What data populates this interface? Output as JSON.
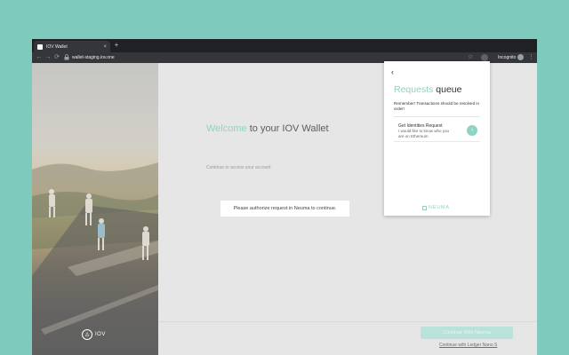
{
  "browser": {
    "tab_title": "IOV Wallet",
    "tab_close": "×",
    "new_tab": "+",
    "back": "←",
    "forward": "→",
    "reload": "⟳",
    "lock": "🔒",
    "url": "wallet-staging.iov.one",
    "star": "☆",
    "incognito": "Incognito",
    "menu": "⋮"
  },
  "page": {
    "welcome_accent": "Welcome",
    "welcome_rest": " to your IOV Wallet",
    "subtitle": "Continue to access your account",
    "authorize_message": "Please authorize request in Neuma to continue.",
    "logo_glyph": "◬",
    "logo_text": "IOV",
    "continue_button": "Continue With Neuma",
    "ledger_link": "Continue with Ledger Nano S"
  },
  "popup": {
    "back": "‹",
    "title_accent": "Requests",
    "title_rest": " queue",
    "note": "Remember! Transactions should be resolved in order!",
    "request": {
      "title": "Get Identities Request",
      "description": "I would like to know who you are on Ethereum",
      "arrow": "›"
    },
    "brand": "NEUMA"
  },
  "colors": {
    "accent": "#8fd3c5",
    "page_background": "#7ecbbd",
    "app_background": "#e6e6e6",
    "chrome_dark": "#202124"
  },
  "icons": [
    "close-icon",
    "back-arrow-icon",
    "forward-arrow-icon",
    "reload-icon",
    "lock-icon",
    "star-icon",
    "extension-icon",
    "incognito-icon",
    "menu-icon",
    "chevron-left-icon",
    "chevron-right-icon",
    "iov-logo-icon",
    "neuma-logo-icon"
  ]
}
